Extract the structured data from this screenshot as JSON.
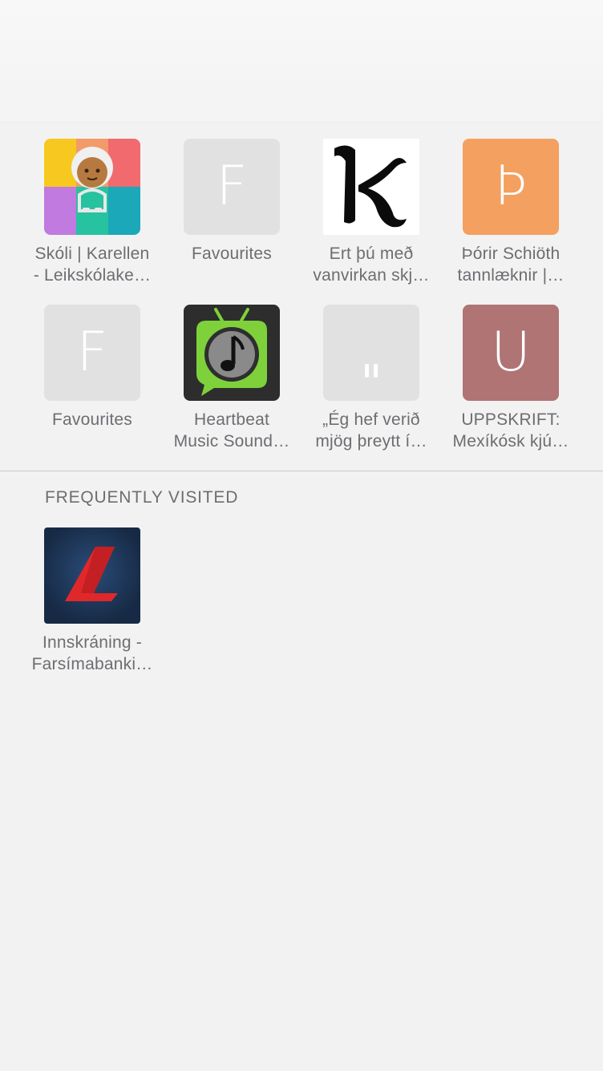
{
  "favorites": [
    {
      "line1": "Skóli | Karellen",
      "line2": "- Leikskólake…",
      "icon": "karellen-logo"
    },
    {
      "line1": "Favourites",
      "line2": "",
      "icon": "letter-f",
      "letter": "F",
      "color": "#e1e1e1"
    },
    {
      "line1": "Ert þú með",
      "line2": "vanvirkan skj…",
      "icon": "letter-k-blackletter",
      "letter": "K",
      "color": "#ffffff"
    },
    {
      "line1": "Þórir Schiöth",
      "line2": "tannlæknir |…",
      "icon": "letter-thorn",
      "letter": "Þ",
      "color": "#f4a060"
    },
    {
      "line1": "Favourites",
      "line2": "",
      "icon": "letter-f",
      "letter": "F",
      "color": "#e1e1e1"
    },
    {
      "line1": "Heartbeat",
      "line2": "Music Sound…",
      "icon": "music-tv-icon",
      "color": "#2d2d2d"
    },
    {
      "line1": "„Ég hef verið",
      "line2": "mjög þreytt í…",
      "icon": "quote-icon",
      "letter": "\"",
      "color": "#e1e1e1"
    },
    {
      "line1": "UPPSKRIFT:",
      "line2": "Mexíkósk kjú…",
      "icon": "letter-u",
      "letter": "U",
      "color": "#b07474"
    }
  ],
  "frequently_visited": {
    "title": "FREQUENTLY VISITED",
    "items": [
      {
        "line1": "Innskráning -",
        "line2": "Farsímabanki…",
        "icon": "landsbankinn-logo",
        "color": "#1b2f4d"
      }
    ]
  }
}
